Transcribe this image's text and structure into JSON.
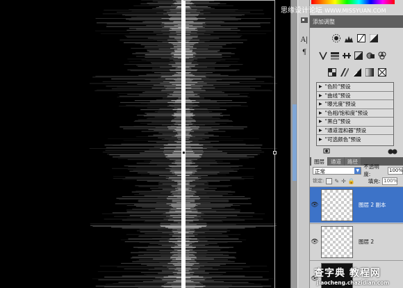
{
  "watermark_top": {
    "text": "思缘设计论坛",
    "url": "WWW.MISSYUAN.COM"
  },
  "adjustments": {
    "header": "添加调整",
    "presets": [
      "\"色阶\"预设",
      "\"曲线\"预设",
      "\"曝光度\"预设",
      "\"色相/饱和度\"预设",
      "\"黑白\"预设",
      "\"通道混和器\"预设",
      "\"可选颜色\"预设"
    ]
  },
  "layers_panel": {
    "tabs": [
      "图层",
      "通道",
      "路径"
    ],
    "blend_mode": "正常",
    "opacity_label": "不透明度:",
    "opacity_value": "100%",
    "lock_label": "锁定:",
    "fill_label": "填充:",
    "fill_value": "100%",
    "layers": [
      {
        "name": "图层 2 副本",
        "selected": true
      },
      {
        "name": "图层 2",
        "selected": false
      },
      {
        "name": "",
        "selected": false
      }
    ]
  },
  "tools": {
    "icons": [
      "character-icon",
      "paragraph-icon"
    ],
    "labels": [
      "A|",
      "¶"
    ]
  },
  "watermark_bottom": {
    "big": "查字典 教程网",
    "small": "jiaocheng.chazidian.com"
  },
  "colors": {
    "selection": "#3d73c8",
    "panel": "#d4d4d4",
    "canvas": "#000000"
  }
}
